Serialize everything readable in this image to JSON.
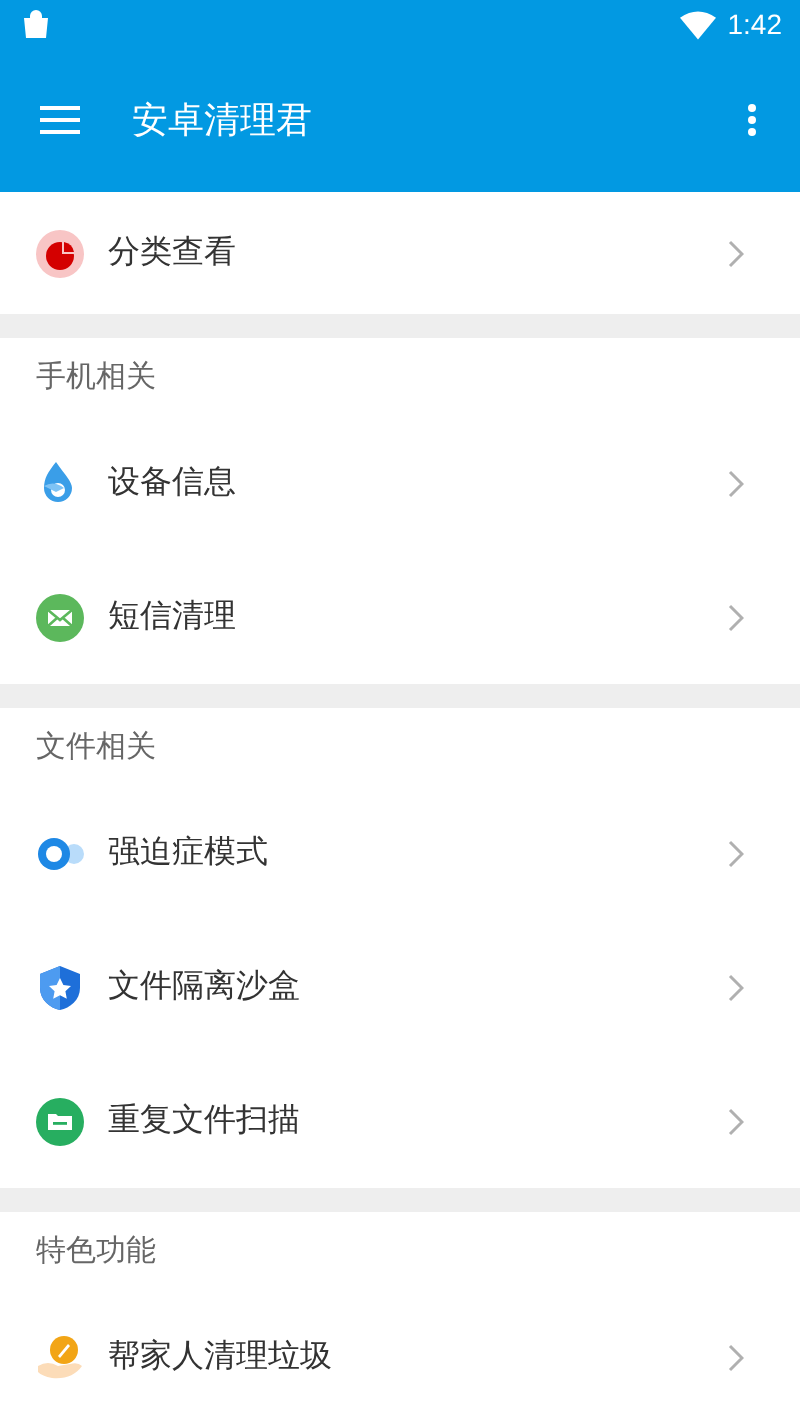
{
  "status_bar": {
    "time": "1:42"
  },
  "toolbar": {
    "title": "安卓清理君"
  },
  "sections": [
    {
      "items": [
        {
          "label": "分类查看",
          "kind": "pie"
        }
      ]
    },
    {
      "title": "手机相关",
      "items": [
        {
          "label": "设备信息",
          "kind": "drop"
        },
        {
          "label": "短信清理",
          "kind": "mail"
        }
      ]
    },
    {
      "title": "文件相关",
      "items": [
        {
          "label": "强迫症模式",
          "kind": "toggle"
        },
        {
          "label": "文件隔离沙盒",
          "kind": "shield"
        },
        {
          "label": "重复文件扫描",
          "kind": "folder"
        }
      ]
    },
    {
      "title": "特色功能",
      "items": [
        {
          "label": "帮家人清理垃圾",
          "kind": "hand"
        }
      ]
    }
  ]
}
